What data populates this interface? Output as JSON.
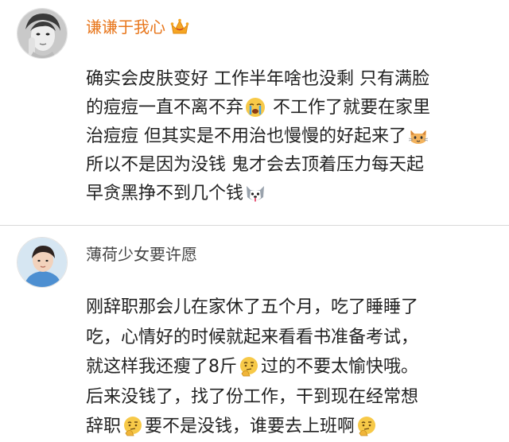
{
  "comments": [
    {
      "username": "谦谦于我心",
      "badge_icon": "crown-badge-icon",
      "lines": [
        [
          "确实会皮肤变好 工作半年啥也没剩 只有满脸"
        ],
        [
          "的痘痘一直不离不弃",
          " 不工作了就要在家里"
        ],
        [
          "治痘痘 但其实是不用治也慢慢的好起来了"
        ],
        [
          "所以不是因为没钱 鬼才会去顶着压力每天起"
        ],
        [
          "早贪黑挣不到几个钱"
        ]
      ],
      "emojis": [
        "crying-face-emoji",
        "cat-face-emoji",
        "husky-face-emoji"
      ]
    },
    {
      "username": "薄荷少女要许愿",
      "lines": [
        [
          "刚辞职那会儿在家休了五个月，吃了睡睡了"
        ],
        [
          "吃，心情好的时候就起来看看书准备考试，"
        ],
        [
          "就这样我还瘦了8斤",
          "过的不要太愉快哦。"
        ],
        [
          "后来没钱了，找了份工作，干到现在经常想"
        ],
        [
          "辞职",
          "要不是没钱，谁要去上班啊"
        ]
      ],
      "emojis": [
        "thinking-face-emoji",
        "thinking-face-emoji",
        "thinking-face-emoji"
      ]
    }
  ],
  "colors": {
    "vip_username": "#e8771d",
    "username": "#444444",
    "divider": "#d9d9d9"
  }
}
